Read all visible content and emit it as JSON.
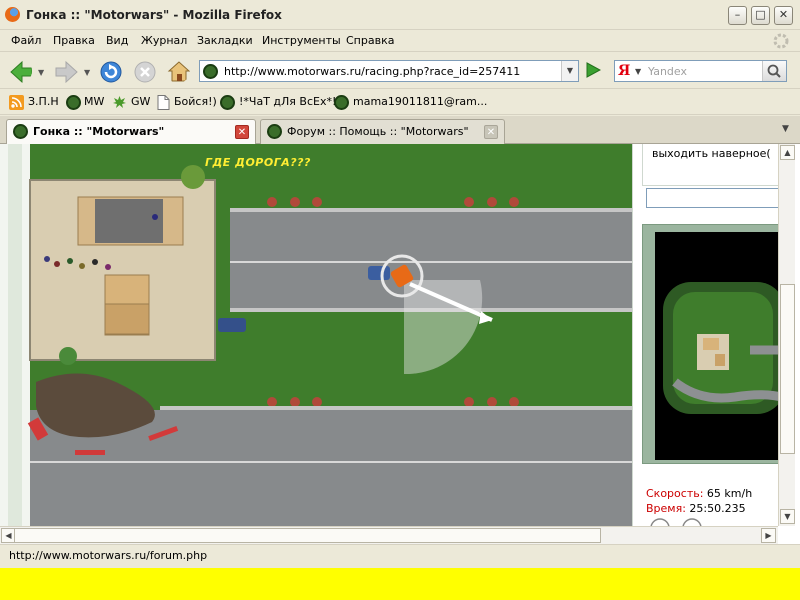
{
  "window": {
    "title": "Гонка :: \"Motorwars\" - Mozilla Firefox",
    "minimize": "–",
    "maximize": "□",
    "close": "✕"
  },
  "menu": [
    "Файл",
    "Правка",
    "Вид",
    "Журнал",
    "Закладки",
    "Инструменты",
    "Справка"
  ],
  "navigation": {
    "url": "http://www.motorwars.ru/racing.php?race_id=257411",
    "search_engine_label": "Я",
    "search_placeholder": "Yandex"
  },
  "bookmarks": [
    {
      "label": "З.П.Н",
      "icon": "rss-icon"
    },
    {
      "label": "MW",
      "icon": "site-icon"
    },
    {
      "label": "GW",
      "icon": "leaf-icon"
    },
    {
      "label": "Бойся!)",
      "icon": "page-icon"
    },
    {
      "label": "!*ЧаТ дЛя ВсЕх*!",
      "icon": "site-icon"
    },
    {
      "label": "mama19011811@ram...",
      "icon": "site-icon"
    }
  ],
  "tabs": [
    {
      "title": "Гонка :: \"Motorwars\"",
      "active": true
    },
    {
      "title": "Форум :: Помощь :: \"Motorwars\"",
      "active": false
    }
  ],
  "game": {
    "overlay_text": "ГДЕ ДОРОГА???"
  },
  "panel": {
    "chat_line": "выходить наверное(",
    "speed_label": "Скорость:",
    "speed_value": "65 km/h",
    "time_label": "Время:",
    "time_value": "25:50.235"
  },
  "status": {
    "text": "http://www.motorwars.ru/forum.php"
  },
  "colors": {
    "accent_red": "#cc0000",
    "chrome": "#ece9d8",
    "desktop": "#ffff00"
  }
}
